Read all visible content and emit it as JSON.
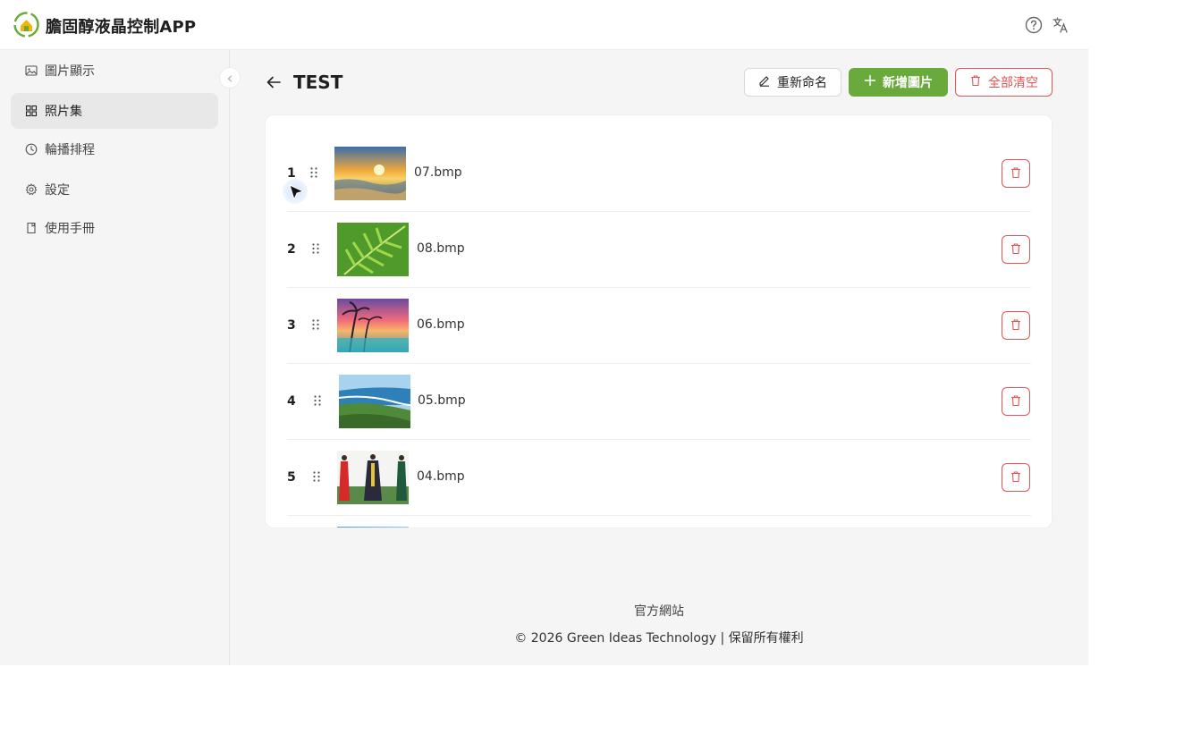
{
  "header": {
    "app_title": "膽固醇液晶控制APP",
    "help_icon": "help-circle-icon",
    "language_icon": "translate-icon"
  },
  "sidebar": {
    "items": [
      {
        "label": "圖片顯示",
        "icon": "image-icon",
        "active": false
      },
      {
        "label": "照片集",
        "icon": "grid-icon",
        "active": true
      },
      {
        "label": "輪播排程",
        "icon": "clock-icon",
        "active": false
      },
      {
        "label": "設定",
        "icon": "gear-icon",
        "active": false
      },
      {
        "label": "使用手冊",
        "icon": "book-icon",
        "active": false
      }
    ]
  },
  "page": {
    "title": "TEST",
    "buttons": {
      "rename": "重新命名",
      "add": "新增圖片",
      "clear": "全部清空"
    }
  },
  "photos": [
    {
      "index": "1",
      "filename": "07.bmp"
    },
    {
      "index": "2",
      "filename": "08.bmp"
    },
    {
      "index": "3",
      "filename": "06.bmp"
    },
    {
      "index": "4",
      "filename": "05.bmp"
    },
    {
      "index": "5",
      "filename": "04.bmp"
    }
  ],
  "footer": {
    "link": "官方網站",
    "copyright": "© 2026 Green Ideas Technology | 保留所有權利"
  },
  "colors": {
    "accent_green": "#6aaa3c",
    "danger_red": "#e05555"
  }
}
